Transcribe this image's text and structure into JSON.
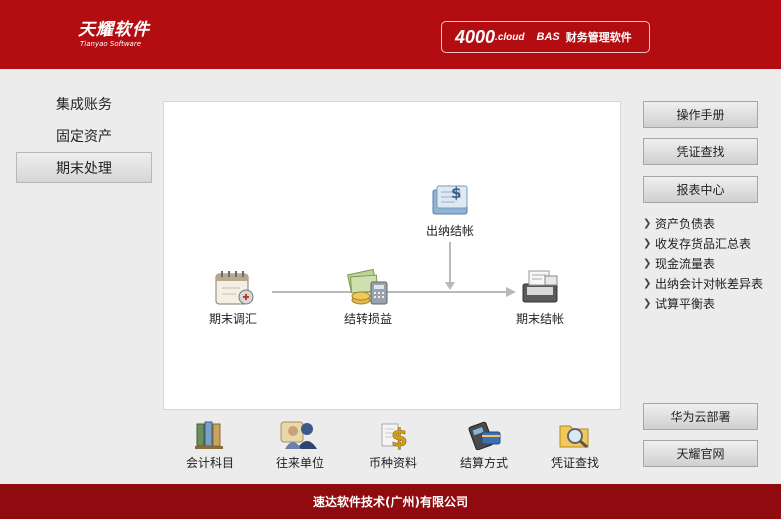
{
  "header": {
    "logo_cn": "天耀软件",
    "logo_en": "Tianyao Software",
    "brand_num": "4000",
    "brand_cloud": ".cloud",
    "brand_bas": "BAS",
    "brand_desc": "财务管理软件"
  },
  "left_nav": [
    {
      "label": "集成账务",
      "active": false
    },
    {
      "label": "固定资产",
      "active": false
    },
    {
      "label": "期末处理",
      "active": true
    }
  ],
  "flow": {
    "nodes": [
      {
        "label": "出纳结帐",
        "icon": "cashier-close-icon"
      },
      {
        "label": "期末调汇",
        "icon": "calendar-exchange-icon"
      },
      {
        "label": "结转损益",
        "icon": "money-calculator-icon"
      },
      {
        "label": "期末结帐",
        "icon": "register-close-icon"
      }
    ]
  },
  "toolbar": [
    {
      "label": "会计科目",
      "icon": "ledger-books-icon"
    },
    {
      "label": "往来单位",
      "icon": "contacts-icon"
    },
    {
      "label": "币种资料",
      "icon": "currency-icon"
    },
    {
      "label": "结算方式",
      "icon": "settlement-card-icon"
    },
    {
      "label": "凭证查找",
      "icon": "voucher-search-icon"
    }
  ],
  "right": {
    "manual": "操作手册",
    "voucher_search": "凭证查找",
    "report_center": "报表中心",
    "reports": [
      "资产负债表",
      "收发存货品汇总表",
      "现金流量表",
      "出纳会计对帐差异表",
      "试算平衡表"
    ],
    "huawei": "华为云部署",
    "official": "天耀官网"
  },
  "footer": {
    "text": "速达软件技术(广州)有限公司"
  },
  "colors": {
    "header": "#b30d12",
    "footer": "#8f0b0f",
    "background": "#ececec"
  }
}
